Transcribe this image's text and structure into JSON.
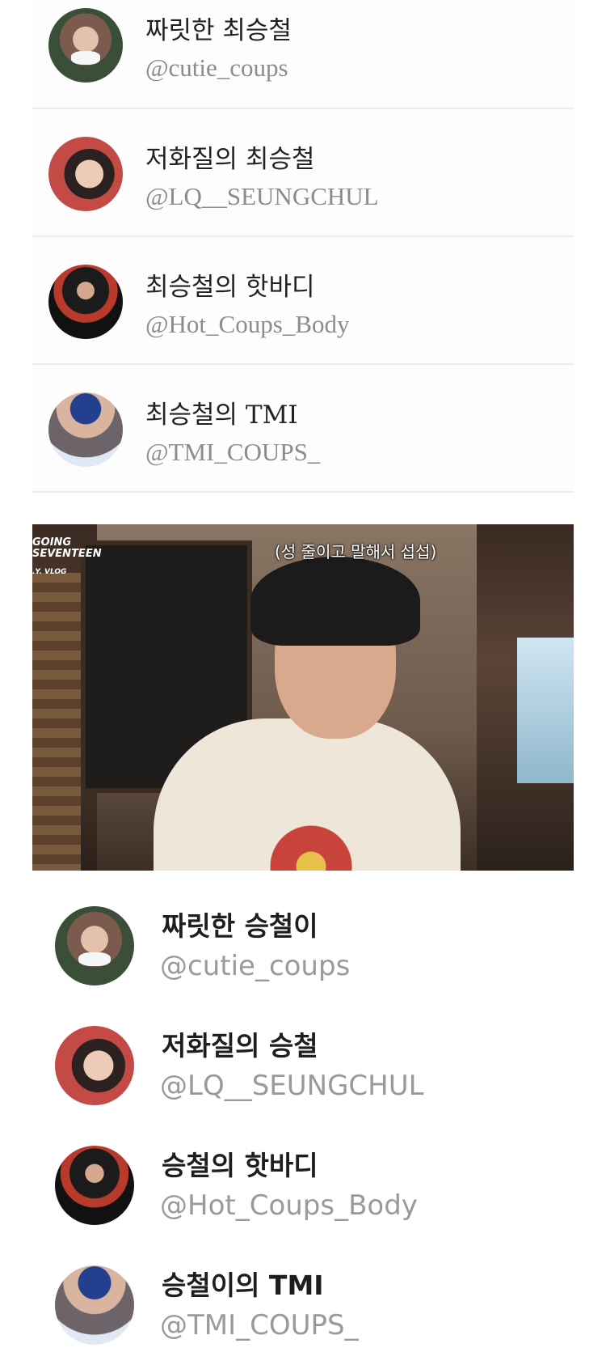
{
  "top_list": [
    {
      "name": "짜릿한 최승철",
      "handle": "@cutie_coups",
      "avatar": "avatar-photo-masked"
    },
    {
      "name": "저화질의 최승철",
      "handle": "@LQ__SEUNGCHUL",
      "avatar": "avatar-photo-red"
    },
    {
      "name": "최승철의 핫바디",
      "handle": "@Hot_Coups_Body",
      "avatar": "avatar-photo-stage"
    },
    {
      "name": "최승철의 TMI",
      "handle": "@TMI_COUPS_",
      "avatar": "avatar-photo-blue-hat"
    }
  ],
  "video": {
    "brand": "GOING\nSEVENTEEN",
    "brand_tag": ".Y. VLOG",
    "caption": "(성 줄이고 말해서 섭섭)"
  },
  "bottom_list": [
    {
      "name": "짜릿한 승철이",
      "handle": "@cutie_coups",
      "avatar": "avatar-photo-masked"
    },
    {
      "name": "저화질의 승철",
      "handle": "@LQ__SEUNGCHUL",
      "avatar": "avatar-photo-red"
    },
    {
      "name": "승철의 핫바디",
      "handle": "@Hot_Coups_Body",
      "avatar": "avatar-photo-stage"
    },
    {
      "name": "승철이의 TMI",
      "handle": "@TMI_COUPS_",
      "avatar": "avatar-photo-blue-hat"
    }
  ]
}
